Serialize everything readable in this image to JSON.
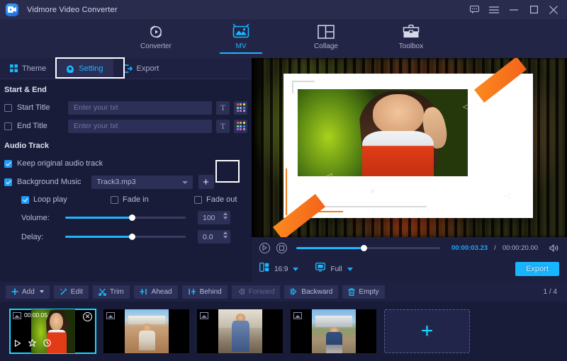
{
  "window": {
    "title": "Vidmore Video Converter",
    "app_icon": "video-camera-icon",
    "controls": [
      {
        "name": "feedback-icon",
        "label": "…"
      },
      {
        "name": "menu-icon",
        "label": "☰"
      },
      {
        "name": "minimize-icon",
        "label": "—"
      },
      {
        "name": "maximize-icon",
        "label": "□"
      },
      {
        "name": "close-icon",
        "label": "✕"
      }
    ]
  },
  "module_nav": {
    "items": [
      {
        "label": "Converter",
        "icon": "converter-icon",
        "active": false
      },
      {
        "label": "MV",
        "icon": "mv-icon",
        "active": true
      },
      {
        "label": "Collage",
        "icon": "collage-icon",
        "active": false
      },
      {
        "label": "Toolbox",
        "icon": "toolbox-icon",
        "active": false
      }
    ]
  },
  "left_tabs": {
    "items": [
      {
        "label": "Theme",
        "icon": "grid-icon",
        "active": false
      },
      {
        "label": "Setting",
        "icon": "gear-icon",
        "active": true
      },
      {
        "label": "Export",
        "icon": "export-icon",
        "active": false
      }
    ]
  },
  "start_end": {
    "section_title": "Start & End",
    "start_title": {
      "label": "Start Title",
      "checked": false,
      "value": "",
      "placeholder": "Enter your txt",
      "font_button": "T",
      "color_button": "color-palette-icon"
    },
    "end_title": {
      "label": "End Title",
      "checked": false,
      "value": "",
      "placeholder": "Enter your txt",
      "font_button": "T",
      "color_button": "color-palette-icon"
    }
  },
  "audio_track": {
    "section_title": "Audio Track",
    "keep_original": {
      "label": "Keep original audio track",
      "checked": true
    },
    "background_music": {
      "label": "Background Music",
      "checked": true,
      "selected": "Track3.mp3",
      "add_button": "+"
    },
    "loop_play": {
      "label": "Loop play",
      "checked": true
    },
    "fade_in": {
      "label": "Fade in",
      "checked": false
    },
    "fade_out": {
      "label": "Fade out",
      "checked": false
    },
    "volume": {
      "label": "Volume:",
      "value": "100",
      "percent": 55
    },
    "delay": {
      "label": "Delay:",
      "value": "0.0",
      "percent": 55
    }
  },
  "preview": {
    "overlay_cursors": [
      "◁",
      "◁",
      "✕",
      "◁"
    ]
  },
  "playback": {
    "play_icon": "play-icon",
    "stop_icon": "stop-icon",
    "progress_percent": 45,
    "current_time": "00:00:03.23",
    "separator": "/",
    "total_time": "00:00:20.00",
    "volume_icon": "speaker-icon",
    "aspect_ratio": {
      "icon": "aspect-ratio-icon",
      "value": "16:9"
    },
    "display_mode": {
      "icon": "monitor-icon",
      "value": "Full"
    },
    "export_button": "Export"
  },
  "toolbar": {
    "buttons": [
      {
        "label": "Add",
        "icon": "plus-icon",
        "has_caret": true,
        "disabled": false
      },
      {
        "label": "Edit",
        "icon": "magic-wand-icon",
        "has_caret": false,
        "disabled": false
      },
      {
        "label": "Trim",
        "icon": "scissors-icon",
        "has_caret": false,
        "disabled": false
      },
      {
        "label": "Ahead",
        "icon": "insert-ahead-icon",
        "has_caret": false,
        "disabled": false
      },
      {
        "label": "Behind",
        "icon": "insert-behind-icon",
        "has_caret": false,
        "disabled": false
      },
      {
        "label": "Forward",
        "icon": "move-forward-icon",
        "has_caret": false,
        "disabled": true
      },
      {
        "label": "Backward",
        "icon": "move-backward-icon",
        "has_caret": false,
        "disabled": false
      },
      {
        "label": "Empty",
        "icon": "trash-icon",
        "has_caret": false,
        "disabled": false
      }
    ],
    "page_counter": "1 / 4"
  },
  "storyboard": {
    "clips": [
      {
        "name": "clip-1",
        "duration": "00:00:05",
        "selected": true,
        "media_class": "m1",
        "tools": [
          "play-icon",
          "star-icon",
          "clock-icon"
        ],
        "close": "✕"
      },
      {
        "name": "clip-2",
        "duration": "",
        "selected": false,
        "media_class": "m2"
      },
      {
        "name": "clip-3",
        "duration": "",
        "selected": false,
        "media_class": "m3"
      },
      {
        "name": "clip-4",
        "duration": "",
        "selected": false,
        "media_class": "m4"
      }
    ],
    "add_tile": "+"
  },
  "annotations": [
    {
      "name": "annotation-setting-tab",
      "target": "Setting"
    },
    {
      "name": "annotation-add-music-button",
      "target": "+"
    }
  ],
  "colors": {
    "accent": "#18b9ff",
    "panel_bg": "#191c38",
    "titlebar_bg": "#2a2c4e",
    "control_bg": "#2c2f56",
    "annotation": "#ffffff"
  }
}
